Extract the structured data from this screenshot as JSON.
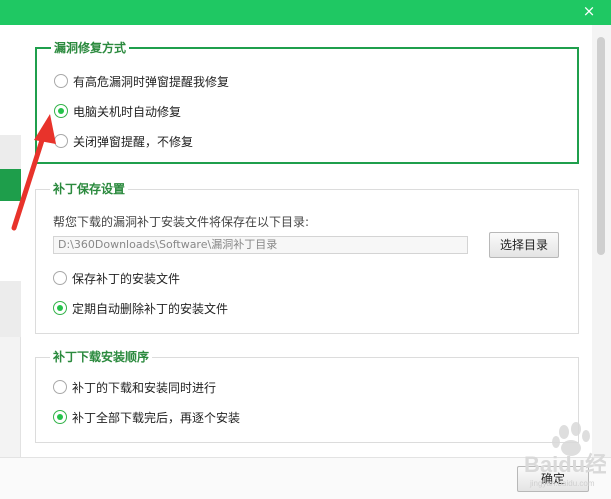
{
  "window": {
    "close_glyph": "×"
  },
  "group_fix_mode": {
    "title": "漏洞修复方式",
    "options": [
      {
        "label": "有高危漏洞时弹窗提醒我修复",
        "checked": false
      },
      {
        "label": "电脑关机时自动修复",
        "checked": true
      },
      {
        "label": "关闭弹窗提醒，不修复",
        "checked": false
      }
    ]
  },
  "group_patch_save": {
    "title": "补丁保存设置",
    "description": "帮您下载的漏洞补丁安装文件将保存在以下目录:",
    "path_value": "D:\\360Downloads\\Software\\漏洞补丁目录",
    "choose_button": "选择目录",
    "options": [
      {
        "label": "保存补丁的安装文件",
        "checked": false
      },
      {
        "label": "定期自动删除补丁的安装文件",
        "checked": true
      }
    ]
  },
  "group_install_order": {
    "title": "补丁下载安装顺序",
    "options": [
      {
        "label": "补丁的下载和安装同时进行",
        "checked": false
      },
      {
        "label": "补丁全部下载完后，再逐个安装",
        "checked": true
      }
    ]
  },
  "footer": {
    "ok_button": "确定"
  },
  "watermark": {
    "text": "Baidu经验",
    "subtext": "jingyan.baidu.com"
  },
  "colors": {
    "titlebar": "#1fc863",
    "accent_green": "#1f9f4c",
    "annotation_arrow": "#e8332b"
  }
}
